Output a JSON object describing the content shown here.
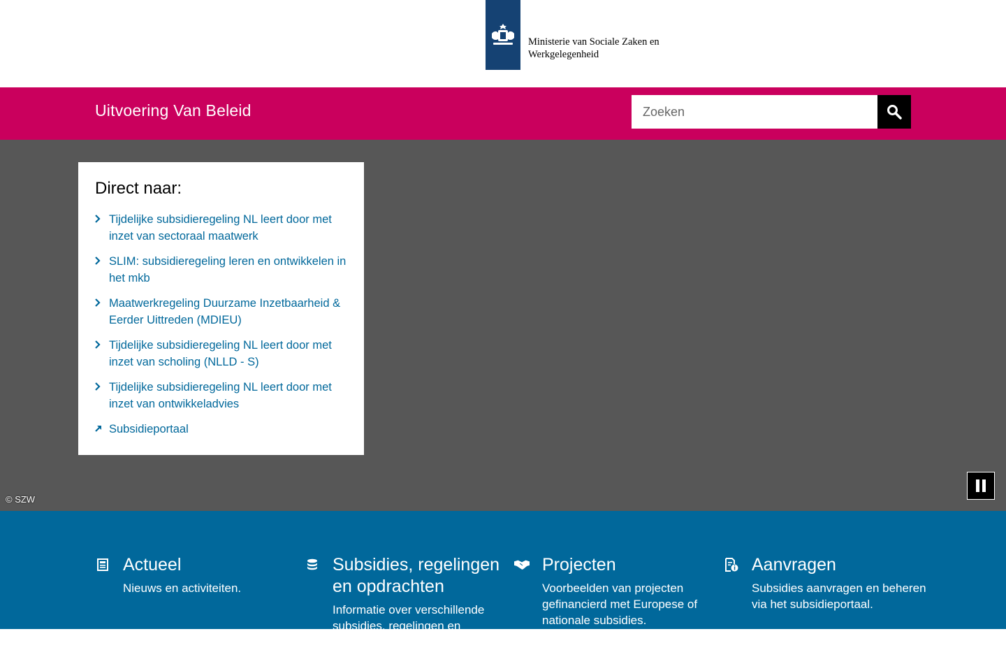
{
  "header": {
    "ministry_line1": "Ministerie van Sociale Zaken en",
    "ministry_line2": "Werkgelegenheid",
    "logo_color": "#154273"
  },
  "site_bar": {
    "title": "Uitvoering Van Beleid",
    "bg_color": "#ca005d",
    "search_placeholder": "Zoeken",
    "search_icon": "search-icon"
  },
  "direct": {
    "title": "Direct naar:",
    "items": [
      {
        "label": "Tijdelijke subsidieregeling NL leert door met inzet van sectoraal maatwerk",
        "icon": "chevron-right-icon"
      },
      {
        "label": "SLIM: subsidieregeling leren en ontwikkelen in het mkb",
        "icon": "chevron-right-icon"
      },
      {
        "label": "Maatwerkregeling Duurzame Inzetbaarheid & Eerder Uittreden (MDIEU)",
        "icon": "chevron-right-icon"
      },
      {
        "label": "Tijdelijke subsidieregeling NL leert door met inzet van scholing (NLLD - S)",
        "icon": "chevron-right-icon"
      },
      {
        "label": "Tijdelijke subsidieregeling NL leert door met inzet van ontwikkeladvies",
        "icon": "chevron-right-icon"
      },
      {
        "label": "Subsidieportaal",
        "icon": "external-link-icon"
      }
    ]
  },
  "hero": {
    "copyright": "© SZW",
    "pause_icon": "pause-icon",
    "bg_color": "#575757"
  },
  "cards": [
    {
      "title": "Actueel",
      "desc": "Nieuws en activiteiten.",
      "icon": "newspaper-icon"
    },
    {
      "title": "Subsidies, regelingen en opdrachten",
      "desc": "Informatie over verschillende subsidies, regelingen en opdrachten.",
      "icon": "coins-icon"
    },
    {
      "title": "Projecten",
      "desc": "Voorbeelden van projecten gefinancierd met Europese of nationale subsidies.",
      "icon": "handshake-icon"
    },
    {
      "title": "Aanvragen",
      "desc": "Subsidies aanvragen en beheren via het subsidieportaal.",
      "icon": "document-info-icon"
    }
  ],
  "blue_color": "#01689b"
}
